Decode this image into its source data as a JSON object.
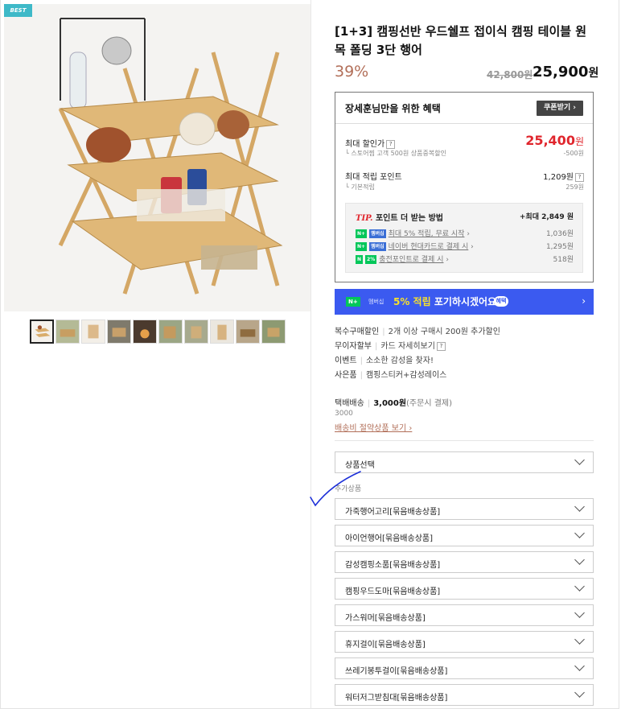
{
  "badge": "BEST",
  "product": {
    "title": "[1+3] 캠핑선반 우드쉘프 접이식 캠핑 테이블 원목 폴딩 3단 행어",
    "discount_rate": "39%",
    "original_price": "42,800원",
    "sale_price": "25,900",
    "sale_currency": "원"
  },
  "thumbnails_count": 10,
  "benefits": {
    "heading": "장세훈님만을 위한 혜택",
    "coupon_button": "쿠폰받기 ›",
    "max_discount_label": "최대 할인가",
    "max_discount_value": "25,400",
    "max_discount_currency": "원",
    "max_discount_sub": "스토어찜 고객 500원 상품중복할인",
    "max_discount_sub_value": "-500원",
    "points_label": "최대 적립 포인트",
    "points_value": "1,209원",
    "points_sub": "기본적립",
    "points_sub_value": "259원",
    "tip_prefix": "TIP.",
    "tip_title": "포인트 더 받는 방법",
    "tip_max": "+최대 2,849 원",
    "tips": [
      {
        "text": "최대 5% 적립, 무료 시작",
        "value": "1,036원"
      },
      {
        "text": "네이버 현대카드로 결제 시",
        "value": "1,295원"
      },
      {
        "text": "충전포인트로 결제 시",
        "value": "518원"
      }
    ],
    "tip_chip_3": "2%"
  },
  "banner": {
    "chip": "N+",
    "chip_label": "멤버십",
    "text_highlight": "5% 적립",
    "text_rest": " 포기하시겠어요?",
    "pill": "혜택",
    "arrow": "›"
  },
  "info": [
    {
      "label": "복수구매할인",
      "value": "2개 이상 구매시 200원 추가할인"
    },
    {
      "label": "무이자할부",
      "value": "카드 자세히보기"
    },
    {
      "label": "이벤트",
      "value": "소소한 감성을 찾자!"
    },
    {
      "label": "사은품",
      "value": "캠핑스티커+감성레이스"
    }
  ],
  "shipping": {
    "label": "택배배송",
    "fee": "3,000원",
    "fee_note": "(주문시 결제)",
    "sub": "3000",
    "link": "배송비 절약상품 보기 ›"
  },
  "option_select": "상품선택",
  "addon_label": "추가상품",
  "addons": [
    "가죽행어고리[묶음배송상품]",
    "아이언행어[묶음배송상품]",
    "감성캠핑소품[묶음배송상품]",
    "캠핑우드도마[묶음배송상품]",
    "가스워머[묶음배송상품]",
    "휴지걸이[묶음배송상품]",
    "쓰레기봉투걸이[묶음배송상품]",
    "워터저그받침대[묶음배송상품]"
  ],
  "colors": {
    "accent_price": "#e0262d",
    "discount": "#b26f59",
    "banner": "#3b5af0",
    "badge": "#3eb9c8"
  }
}
